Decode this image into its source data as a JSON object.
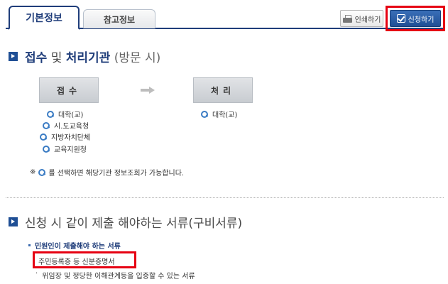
{
  "tabs": [
    {
      "label": "기본정보",
      "active": true
    },
    {
      "label": "참고정보",
      "active": false
    }
  ],
  "toolbar": {
    "print_label": "인쇄하기",
    "apply_label": "신청하기"
  },
  "section1": {
    "title_part1": "접수",
    "title_part2": "및",
    "title_part3": "처리기관",
    "title_part4": "(방문 시)"
  },
  "flow": {
    "receive_label": "접수",
    "process_label": "처리"
  },
  "receive_agencies": [
    "대학(교)",
    "시.도교육청",
    "지방자치단체",
    "교육지원청"
  ],
  "process_agencies": [
    "대학(교)"
  ],
  "note": {
    "mark": "※",
    "text": "를 선택하면 해당기관 정보조회가 가능합니다."
  },
  "section2": {
    "title": "신청 시 같이 제출 해야하는 서류(구비서류)"
  },
  "documents": {
    "subtitle": "민원인이 제출해야 하는 서류",
    "items": [
      "주민등록증 등 신분증명서",
      "위임장 및 정당한 이해관계등을 입증할 수 있는 서류"
    ]
  },
  "colors": {
    "brand_navy": "#1f3d7a",
    "accent_blue": "#1f4f95",
    "highlight_red": "#e60012"
  }
}
